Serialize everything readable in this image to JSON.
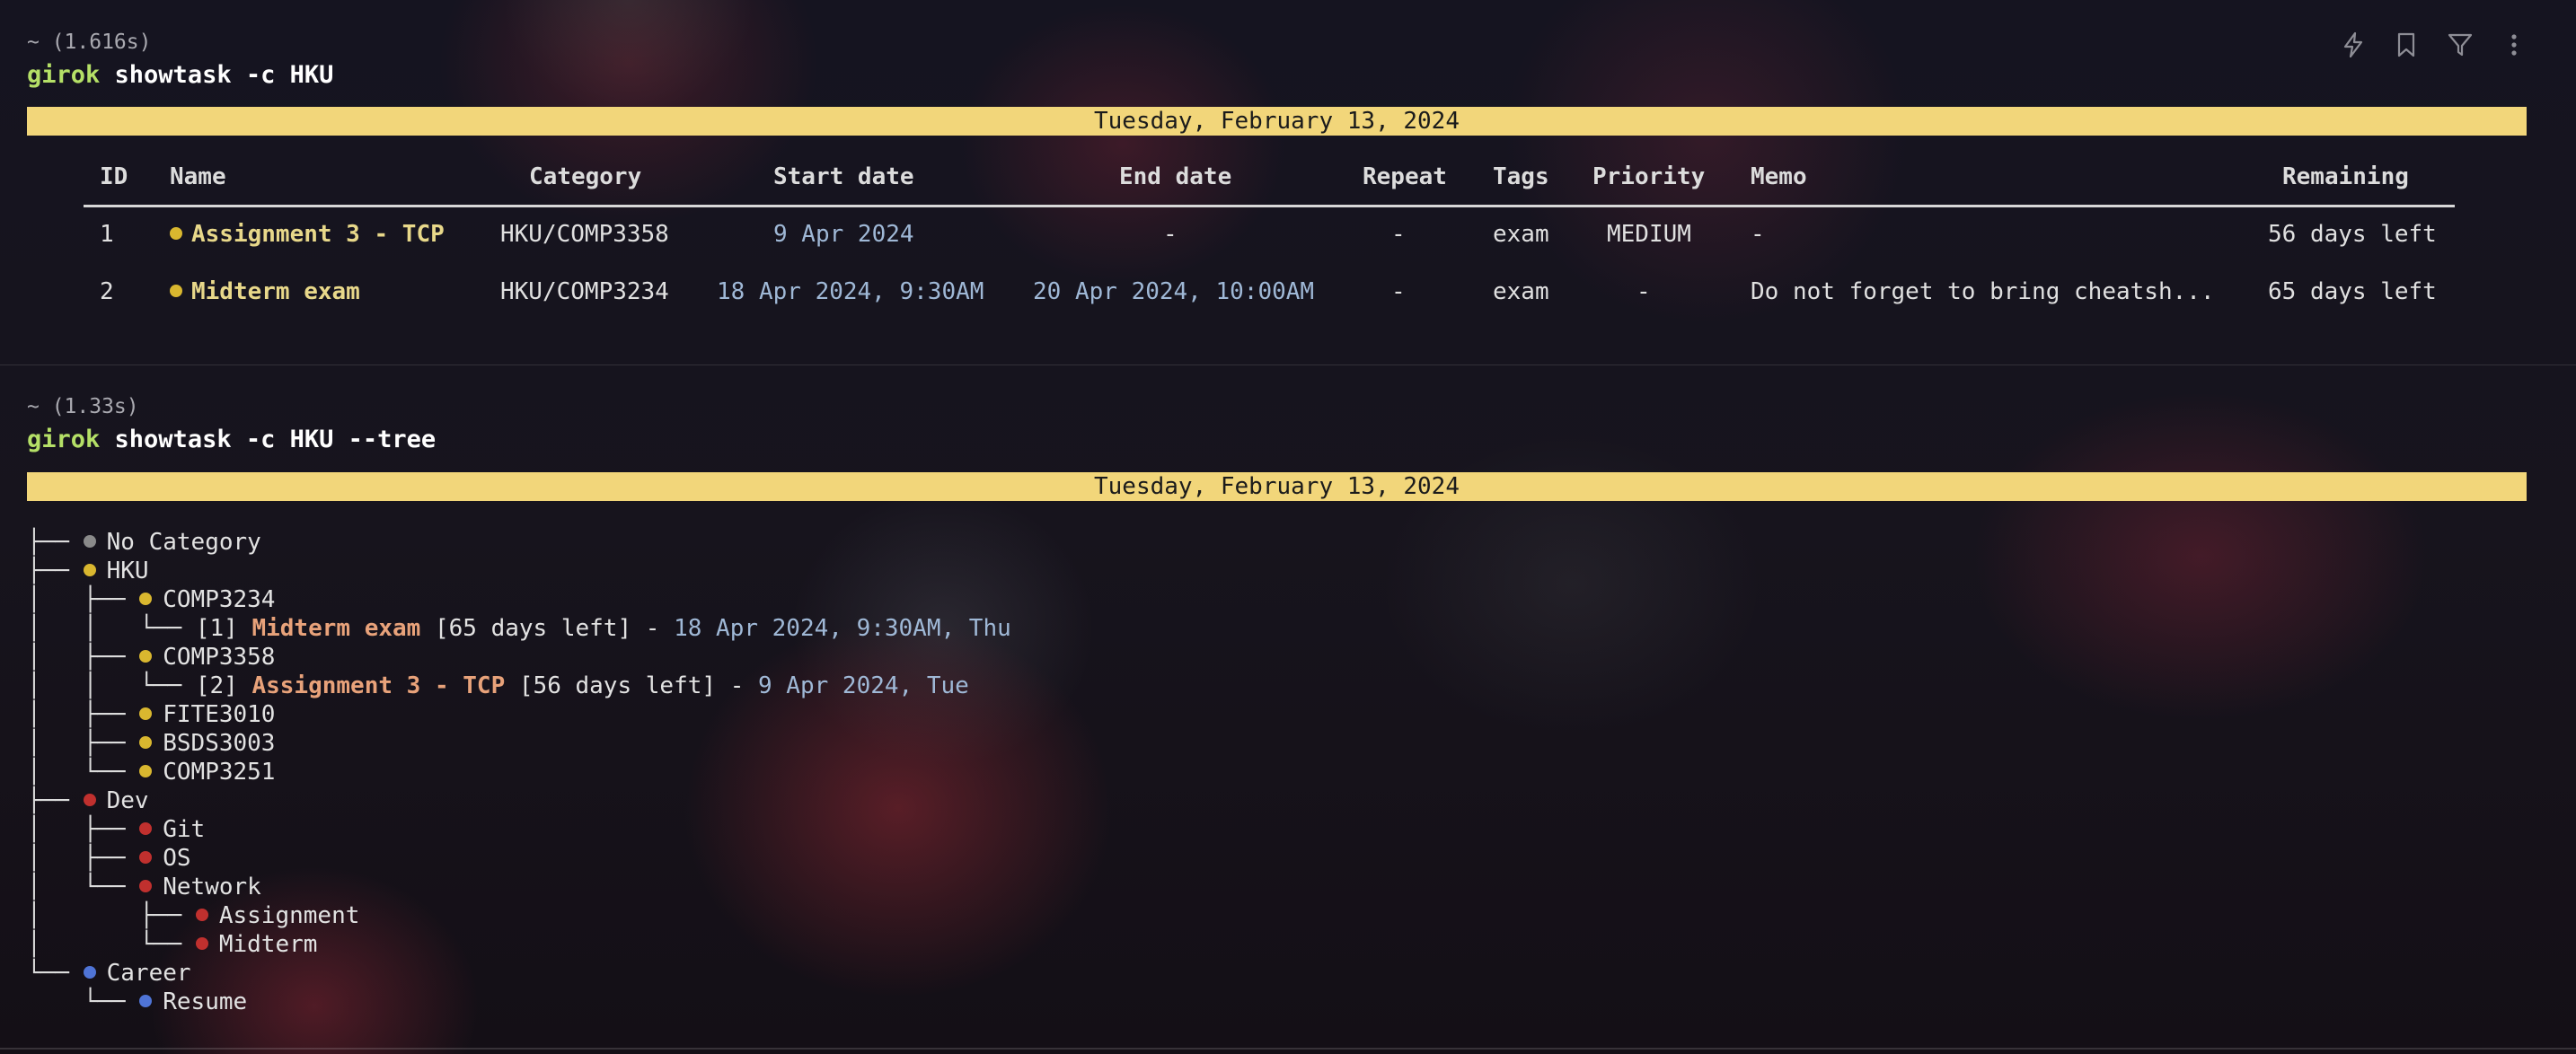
{
  "block1": {
    "timing": "~ (1.616s)",
    "command_prog": "girok",
    "command_args": " showtask -c HKU",
    "banner": "Tuesday, February 13, 2024",
    "headers": [
      "ID",
      "Name",
      "Category",
      "Start date",
      "End date",
      "Repeat",
      "Tags",
      "Priority",
      "Memo",
      "Remaining"
    ],
    "rows": [
      {
        "id": "1",
        "name": "Assignment 3 - TCP",
        "category": "HKU/COMP3358",
        "start": "9 Apr 2024",
        "end": "-",
        "repeat": "-",
        "tags": "exam",
        "priority": "MEDIUM",
        "memo": "-",
        "remaining": "56 days left",
        "dot_color": "#d9b72f"
      },
      {
        "id": "2",
        "name": "Midterm exam",
        "category": "HKU/COMP3234",
        "start": "18 Apr 2024, 9:30AM",
        "end": "20 Apr 2024, 10:00AM",
        "repeat": "-",
        "tags": "exam",
        "priority": "-",
        "memo": "Do not forget to bring cheatsh...",
        "remaining": "65 days left",
        "dot_color": "#d9b72f"
      }
    ]
  },
  "block2": {
    "timing": "~ (1.33s)",
    "command_prog": "girok",
    "command_args": " showtask -c HKU --tree",
    "banner": "Tuesday, February 13, 2024",
    "tree": [
      {
        "prefix": "├── ",
        "dot": "#8a8a8a",
        "label": "No Category"
      },
      {
        "prefix": "├── ",
        "dot": "#d9b72f",
        "label": "HKU"
      },
      {
        "prefix": "│   ├── ",
        "dot": "#d9b72f",
        "label": "COMP3234"
      },
      {
        "prefix": "│   │   └── ",
        "task_index": "[1] ",
        "task_name": "Midterm exam",
        "task_remaining": " [65 days left] - ",
        "task_date": "18 Apr 2024, 9:30AM, Thu"
      },
      {
        "prefix": "│   ├── ",
        "dot": "#d9b72f",
        "label": "COMP3358"
      },
      {
        "prefix": "│   │   └── ",
        "task_index": "[2] ",
        "task_name": "Assignment 3 - TCP",
        "task_remaining": " [56 days left] - ",
        "task_date": "9 Apr 2024, Tue"
      },
      {
        "prefix": "│   ├── ",
        "dot": "#d9b72f",
        "label": "FITE3010"
      },
      {
        "prefix": "│   ├── ",
        "dot": "#d9b72f",
        "label": "BSDS3003"
      },
      {
        "prefix": "│   └── ",
        "dot": "#d9b72f",
        "label": "COMP3251"
      },
      {
        "prefix": "├── ",
        "dot": "#c0302e",
        "label": "Dev"
      },
      {
        "prefix": "│   ├── ",
        "dot": "#c0302e",
        "label": "Git"
      },
      {
        "prefix": "│   ├── ",
        "dot": "#c0302e",
        "label": "OS"
      },
      {
        "prefix": "│   └── ",
        "dot": "#c0302e",
        "label": "Network"
      },
      {
        "prefix": "│       ├── ",
        "dot": "#c0302e",
        "label": "Assignment"
      },
      {
        "prefix": "│       └── ",
        "dot": "#c0302e",
        "label": "Midterm"
      },
      {
        "prefix": "└── ",
        "dot": "#4f74d6",
        "label": "Career"
      },
      {
        "prefix": "    └── ",
        "dot": "#4f74d6",
        "label": "Resume"
      }
    ]
  },
  "toolbar": {
    "icons": [
      "lightning-icon",
      "bookmark-icon",
      "filter-icon",
      "more-vertical-icon"
    ]
  }
}
